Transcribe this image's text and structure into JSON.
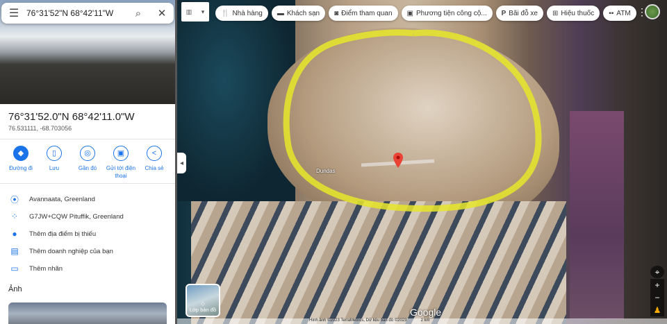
{
  "search": {
    "query": "76°31'52\"N 68°42'11\"W"
  },
  "place": {
    "title": "76°31'52.0\"N 68°42'11.0\"W",
    "decimal": "76.531111, -68.703056"
  },
  "actions": [
    {
      "label": "Đường đi"
    },
    {
      "label": "Lưu"
    },
    {
      "label": "Gần đó"
    },
    {
      "label": "Gửi tới điện thoại"
    },
    {
      "label": "Chia sẻ"
    }
  ],
  "info": [
    {
      "label": "Avannaata, Greenland"
    },
    {
      "label": "G7JW+CQW Pituffik, Greenland"
    },
    {
      "label": "Thêm địa điểm bị thiếu"
    },
    {
      "label": "Thêm doanh nghiệp của bạn"
    },
    {
      "label": "Thêm nhãn"
    }
  ],
  "photos_heading": "Ảnh",
  "chips": [
    {
      "label": "Nhà hàng"
    },
    {
      "label": "Khách sạn"
    },
    {
      "label": "Điểm tham quan"
    },
    {
      "label": "Phương tiện công cộ..."
    },
    {
      "label": "Bãi đỗ xe"
    },
    {
      "label": "Hiệu thuốc"
    },
    {
      "label": "ATM"
    }
  ],
  "map": {
    "place_label": "Dundas",
    "layers_label": "Lớp bản đồ",
    "logo": "Google",
    "attribution": "Hình ảnh ©2023 TerraMetrics, Dữ liệu bản đồ ©2023",
    "scale": "2 km",
    "annotation_color": "#e6e62a",
    "pin_color": "#ea4335"
  }
}
